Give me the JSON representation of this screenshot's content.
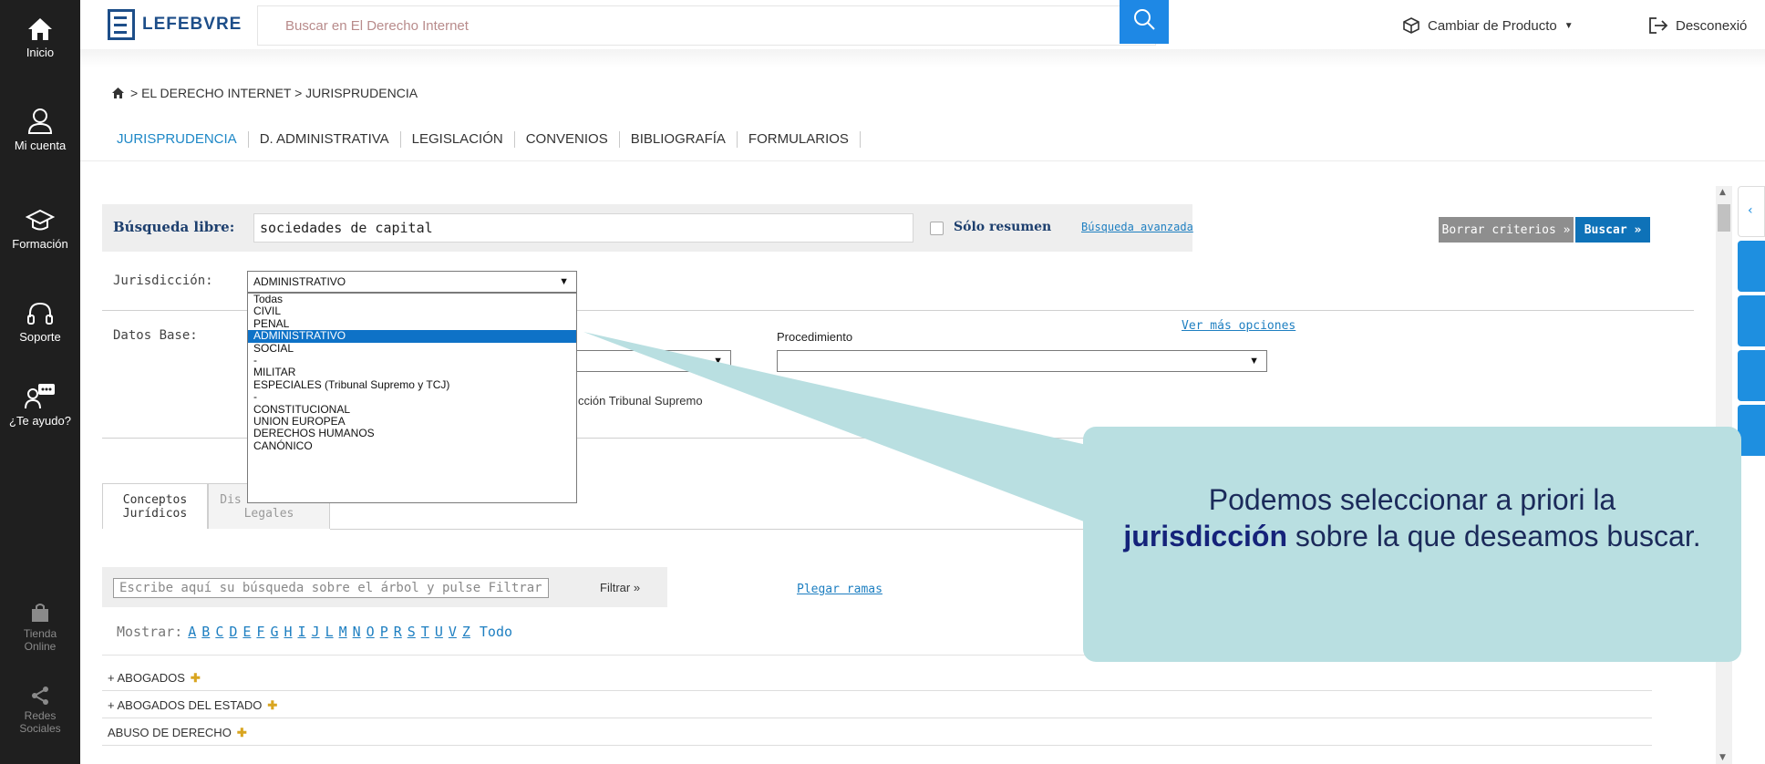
{
  "nav": {
    "items": [
      {
        "label": "Inicio",
        "icon": "home-icon"
      },
      {
        "label": "Mi cuenta",
        "icon": "user-icon"
      },
      {
        "label": "Formación",
        "icon": "graduation-cap-icon"
      },
      {
        "label": "Soporte",
        "icon": "headset-icon"
      },
      {
        "label": "¿Te ayudo?",
        "icon": "chat-user-icon"
      }
    ],
    "bottom": [
      {
        "label": "Tienda Online",
        "icon": "bag-icon"
      },
      {
        "label": "Redes Sociales",
        "icon": "share-icon"
      }
    ]
  },
  "header": {
    "logo": "LEFEBVRE",
    "search_placeholder": "Buscar en El Derecho Internet",
    "cambiar_producto": "Cambiar de Producto",
    "desconexion": "Desconexió"
  },
  "breadcrumb": "> EL DERECHO INTERNET > JURISPRUDENCIA",
  "tabs": [
    "JURISPRUDENCIA",
    "D. ADMINISTRATIVA",
    "LEGISLACIÓN",
    "CONVENIOS",
    "BIBLIOGRAFÍA",
    "FORMULARIOS"
  ],
  "search": {
    "label": "Búsqueda libre:",
    "value": "sociedades de capital",
    "solo_resumen": "Sólo resumen",
    "busqueda_avanzada": "Búsqueda avanzada",
    "borrar": "Borrar criterios »",
    "buscar": "Buscar »"
  },
  "form": {
    "jurisdiccion_label": "Jurisdicción:",
    "jurisdiccion_value": "ADMINISTRATIVO",
    "datos_base_label": "Datos Base:",
    "procedimiento_label": "Procedimiento",
    "ver_mas": "Ver más opciones",
    "partial_text": "cción Tribunal Supremo"
  },
  "dropdown_options": [
    "Todas",
    "CIVIL",
    "PENAL",
    "ADMINISTRATIVO",
    "SOCIAL",
    "-",
    "MILITAR",
    "ESPECIALES (Tribunal Supremo y TCJ)",
    "-",
    "CONSTITUCIONAL",
    "UNION EUROPEA",
    "DERECHOS HUMANOS",
    "CANÓNICO"
  ],
  "dropdown_selected_index": 3,
  "lower_tabs": {
    "conceptos_1": "Conceptos",
    "conceptos_2": "Jurídicos",
    "disp_1": "Dis",
    "disp_2": "Legales"
  },
  "tree": {
    "filter_placeholder": "Escribe aquí su búsqueda sobre el árbol y pulse Filtrar",
    "filtrar": "Filtrar »",
    "plegar": "Plegar ramas",
    "mostrar_label": "Mostrar:",
    "letters": [
      "A",
      "B",
      "C",
      "D",
      "E",
      "F",
      "G",
      "H",
      "I",
      "J",
      "L",
      "M",
      "N",
      "O",
      "P",
      "R",
      "S",
      "T",
      "U",
      "V",
      "Z"
    ],
    "todo": "Todo",
    "items": [
      "+ ABOGADOS",
      "+ ABOGADOS DEL ESTADO",
      "ABUSO DE DERECHO"
    ]
  },
  "callout": {
    "pre": "Podemos seleccionar a priori la",
    "bold": "jurisdicción",
    "post": "sobre la que deseamos buscar."
  },
  "colors": {
    "nav_bg": "#1f1f1f",
    "accent_blue": "#1e88e5",
    "callout_bg": "#b9dfe1",
    "selected_option": "#0e72c7"
  }
}
